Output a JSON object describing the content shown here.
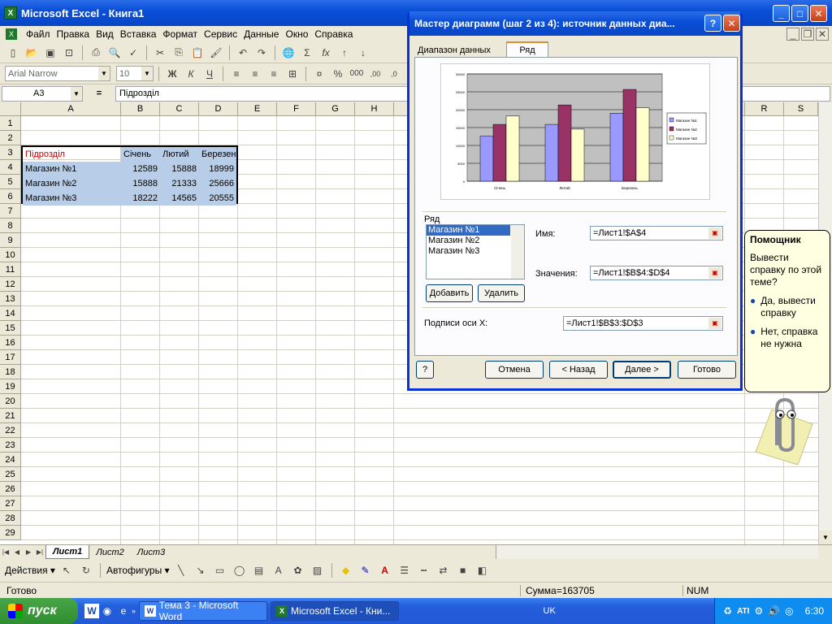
{
  "app": {
    "title": "Microsoft Excel - Книга1",
    "icon": "excel-icon"
  },
  "menu": [
    "Файл",
    "Правка",
    "Вид",
    "Вставка",
    "Формат",
    "Сервис",
    "Данные",
    "Окно",
    "Справка"
  ],
  "format_toolbar": {
    "font": "Arial Narrow",
    "size": "10"
  },
  "formula_bar": {
    "name_box": "A3",
    "equals": "=",
    "content": "Підрозділ"
  },
  "grid": {
    "columns": [
      "A",
      "B",
      "C",
      "D",
      "E",
      "F",
      "G",
      "H",
      "",
      "",
      "",
      "",
      "",
      "",
      "",
      "R",
      "S"
    ],
    "rows": [
      "1",
      "2",
      "3",
      "4",
      "5",
      "6",
      "7",
      "8",
      "9",
      "10",
      "11",
      "12",
      "13",
      "14",
      "15",
      "16",
      "17",
      "18",
      "19",
      "20",
      "21",
      "22",
      "23",
      "24",
      "25",
      "26",
      "27",
      "28",
      "29"
    ],
    "cells": {
      "a3": "Підрозділ",
      "b3": "Січень",
      "c3": "Лютий",
      "d3": "Березень",
      "a4": "Магазин №1",
      "b4": "12589",
      "c4": "15888",
      "d4": "18999",
      "a5": "Магазин №2",
      "b5": "15888",
      "c5": "21333",
      "d5": "25666",
      "a6": "Магазин №3",
      "b6": "18222",
      "c6": "14565",
      "d6": "20555"
    }
  },
  "sheet_tabs": [
    "Лист1",
    "Лист2",
    "Лист3"
  ],
  "draw_toolbar": {
    "actions": "Действия",
    "autoshapes": "Автофигуры"
  },
  "status": {
    "ready": "Готово",
    "sum": "Сумма=163705",
    "num": "NUM"
  },
  "taskbar": {
    "start": "пуск",
    "tasks": [
      "Тема 3 - Microsoft Word",
      "Microsoft Excel - Кни..."
    ],
    "lang": "UK",
    "time": "6:30"
  },
  "dialog": {
    "title": "Мастер диаграмм (шаг 2 из 4): источник данных диа...",
    "tabs": [
      "Диапазон данных",
      "Ряд"
    ],
    "series_label": "Ряд",
    "series_list": [
      "Магазин №1",
      "Магазин №2",
      "Магазин №3"
    ],
    "add": "Добавить",
    "remove": "Удалить",
    "name_label": "Имя:",
    "name_value": "=Лист1!$A$4",
    "values_label": "Значения:",
    "values_value": "=Лист1!$B$4:$D$4",
    "xlabels_label": "Подписи оси X:",
    "xlabels_value": "=Лист1!$B$3:$D$3",
    "cancel": "Отмена",
    "back": "< Назад",
    "next": "Далее >",
    "finish": "Готово"
  },
  "chart_data": {
    "type": "bar",
    "categories": [
      "Січень",
      "Лютий",
      "Березень"
    ],
    "series": [
      {
        "name": "Магазин №1",
        "values": [
          12589,
          15888,
          18999
        ],
        "color": "#9999ff"
      },
      {
        "name": "Магазин №2",
        "values": [
          15888,
          21333,
          25666
        ],
        "color": "#993366"
      },
      {
        "name": "Магазин №3",
        "values": [
          18222,
          14565,
          20555
        ],
        "color": "#ffffcc"
      }
    ],
    "ylim": [
      0,
      30000
    ],
    "yticks": [
      "0",
      "5000",
      "10000",
      "15000",
      "20000",
      "25000",
      "30000"
    ],
    "legend": "right",
    "grid": true,
    "plot_bg": "#c0c0c0"
  },
  "helper": {
    "title": "Помощник",
    "question": "Вывести справку по этой теме?",
    "opt1": "Да, вывести справку",
    "opt2": "Нет, справка не нужна"
  }
}
